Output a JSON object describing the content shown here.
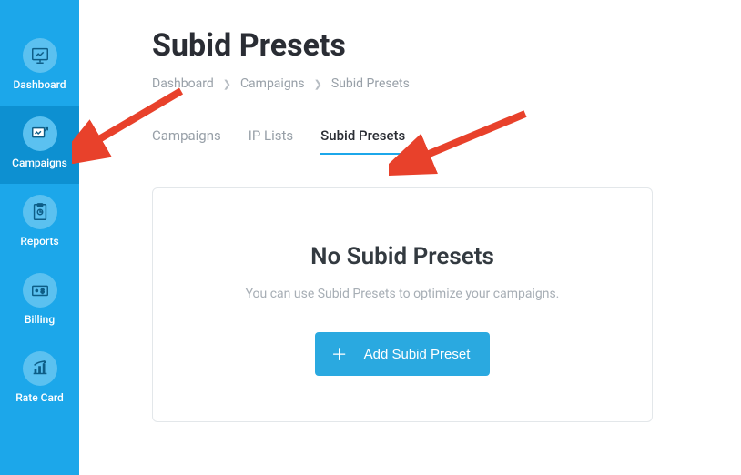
{
  "sidebar": {
    "items": [
      {
        "label": "Dashboard"
      },
      {
        "label": "Campaigns"
      },
      {
        "label": "Reports"
      },
      {
        "label": "Billing"
      },
      {
        "label": "Rate Card"
      }
    ]
  },
  "page": {
    "title": "Subid Presets"
  },
  "breadcrumb": {
    "items": [
      "Dashboard",
      "Campaigns",
      "Subid Presets"
    ]
  },
  "tabs": {
    "items": [
      {
        "label": "Campaigns"
      },
      {
        "label": "IP Lists"
      },
      {
        "label": "Subid Presets"
      }
    ]
  },
  "empty": {
    "title": "No Subid Presets",
    "subtitle": "You can use Subid Presets to optimize your campaigns.",
    "button": "Add Subid Preset"
  },
  "colors": {
    "sidebar_bg": "#1ca7ea",
    "accent": "#2aa9e0"
  }
}
